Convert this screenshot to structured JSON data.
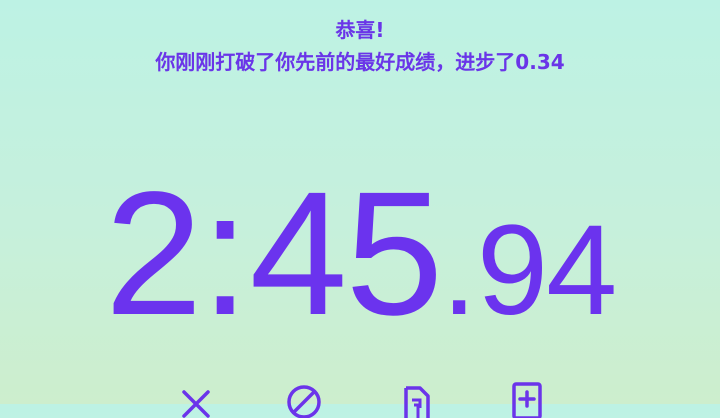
{
  "banner": {
    "line1": "恭喜!",
    "line2": "你刚刚打破了你先前的最好成绩，进步了0.34"
  },
  "timer": {
    "minutes": "2",
    "colon": ":",
    "seconds": "45",
    "dot": ".",
    "hundredths": "94"
  },
  "actions": {
    "icons": [
      "close-icon",
      "dnf-icon",
      "plus-two-icon",
      "comment-icon"
    ]
  },
  "colors": {
    "accent": "#6b34ea",
    "bg_top": "#bdf2e4",
    "bg_bottom": "#cdeecd"
  }
}
